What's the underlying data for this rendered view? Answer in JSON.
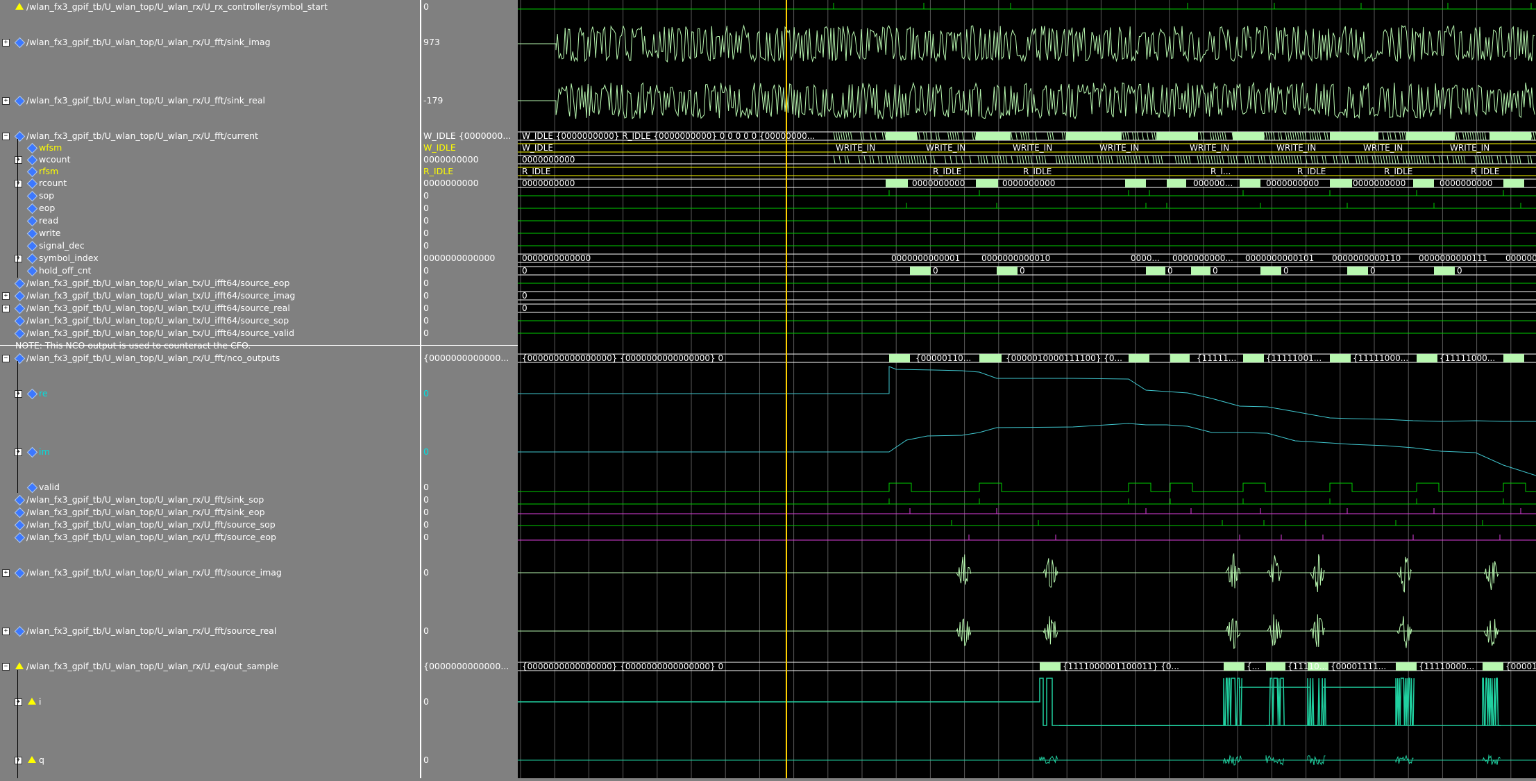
{
  "signals": [
    {
      "name": "/wlan_fx3_gpif_tb/U_wlan_top/U_wlan_rx/U_rx_controller/symbol_start",
      "value": "0"
    },
    {
      "name": "/wlan_fx3_gpif_tb/U_wlan_top/U_wlan_rx/U_fft/sink_imag",
      "value": "973"
    },
    {
      "name": "/wlan_fx3_gpif_tb/U_wlan_top/U_wlan_rx/U_fft/sink_real",
      "value": "-179"
    },
    {
      "name": "/wlan_fx3_gpif_tb/U_wlan_top/U_wlan_rx/U_fft/current",
      "value": "W_IDLE {0000000..."
    },
    {
      "name": "wfsm",
      "value": "W_IDLE"
    },
    {
      "name": "wcount",
      "value": "0000000000"
    },
    {
      "name": "rfsm",
      "value": "R_IDLE"
    },
    {
      "name": "rcount",
      "value": "0000000000"
    },
    {
      "name": "sop",
      "value": "0"
    },
    {
      "name": "eop",
      "value": "0"
    },
    {
      "name": "read",
      "value": "0"
    },
    {
      "name": "write",
      "value": "0"
    },
    {
      "name": "signal_dec",
      "value": "0"
    },
    {
      "name": "symbol_index",
      "value": "0000000000000"
    },
    {
      "name": "hold_off_cnt",
      "value": "0"
    },
    {
      "name": "/wlan_fx3_gpif_tb/U_wlan_top/U_wlan_tx/U_ifft64/source_eop",
      "value": "0"
    },
    {
      "name": "/wlan_fx3_gpif_tb/U_wlan_top/U_wlan_tx/U_ifft64/source_imag",
      "value": "0"
    },
    {
      "name": "/wlan_fx3_gpif_tb/U_wlan_top/U_wlan_tx/U_ifft64/source_real",
      "value": "0"
    },
    {
      "name": "/wlan_fx3_gpif_tb/U_wlan_top/U_wlan_tx/U_ifft64/source_sop",
      "value": "0"
    },
    {
      "name": "/wlan_fx3_gpif_tb/U_wlan_top/U_wlan_tx/U_ifft64/source_valid",
      "value": "0"
    },
    {
      "name": "/wlan_fx3_gpif_tb/U_wlan_top/U_wlan_rx/U_fft/nco_outputs",
      "value": "{0000000000000..."
    },
    {
      "name": "re",
      "value": "0"
    },
    {
      "name": "im",
      "value": "0"
    },
    {
      "name": "valid",
      "value": "0"
    },
    {
      "name": "/wlan_fx3_gpif_tb/U_wlan_top/U_wlan_rx/U_fft/sink_sop",
      "value": "0"
    },
    {
      "name": "/wlan_fx3_gpif_tb/U_wlan_top/U_wlan_rx/U_fft/sink_eop",
      "value": "0"
    },
    {
      "name": "/wlan_fx3_gpif_tb/U_wlan_top/U_wlan_rx/U_fft/source_sop",
      "value": "0"
    },
    {
      "name": "/wlan_fx3_gpif_tb/U_wlan_top/U_wlan_rx/U_fft/source_eop",
      "value": "0"
    },
    {
      "name": "/wlan_fx3_gpif_tb/U_wlan_top/U_wlan_rx/U_fft/source_imag",
      "value": "0"
    },
    {
      "name": "/wlan_fx3_gpif_tb/U_wlan_top/U_wlan_rx/U_fft/source_real",
      "value": "0"
    },
    {
      "name": "/wlan_fx3_gpif_tb/U_wlan_top/U_wlan_rx/U_eq/out_sample",
      "value": "{0000000000000..."
    },
    {
      "name": "i",
      "value": "0"
    },
    {
      "name": "q",
      "value": "0"
    }
  ],
  "note": "NOTE: This NCO output is used to counteract the CFO.",
  "wave_text": {
    "current_start": "W_IDLE {0000000000} R_IDLE {0000000000} 0 0 0 0 0 {00000000...",
    "wfsm_start": "W_IDLE",
    "wfsm_states": [
      "WRITE_IN",
      "WRITE_IN",
      "WRITE_IN",
      "WRITE_IN",
      "WRITE_IN",
      "WRITE_IN",
      "WRITE_IN",
      "WRITE_IN"
    ],
    "wcount_start": "0000000000",
    "rfsm_start": "R_IDLE",
    "rfsm_states": [
      "R_IDLE",
      "R_IDLE",
      "R_I...",
      "R_IDLE",
      "R_IDLE",
      "R_IDLE"
    ],
    "rcount_start": "0000000000",
    "rcount_vals": [
      "0000000000",
      "0000000000",
      "000000...",
      "0000000000",
      "0000000000",
      "0000000000"
    ],
    "symidx_start": "0000000000000",
    "symidx_vals": [
      "0000000000001",
      "0000000000010",
      "0000...",
      "0000000000...",
      "0000000000101",
      "0000000000110",
      "0000000000111",
      "000000"
    ],
    "holdoff_start": "0",
    "holdoff_vals": [
      "0",
      "0",
      "0",
      "0",
      "0",
      "0",
      "0"
    ],
    "ifft_imag_start": "0",
    "ifft_real_start": "0",
    "nco_start": "{0000000000000000} {0000000000000000} 0",
    "nco_vals": [
      "{00000110...",
      "{0000010000111100} {0...",
      "{11111...",
      "{11111001...",
      "{11111000...",
      "{11111000..."
    ],
    "eq_start": "{0000000000000000} {0000000000000000} 0",
    "eq_vals": [
      "{1111000001100011} {0...",
      "{...",
      "{11110...",
      "{00001111...",
      "{11110000...",
      "{00001"
    ]
  },
  "colors": {
    "waveform": "#b8f7b0",
    "logic": "#00d000",
    "state": "#ffffff",
    "yellow": "#ffff00",
    "cyan": "#40c8d0",
    "magenta": "#e040e0",
    "cursor": "#ffd000"
  }
}
